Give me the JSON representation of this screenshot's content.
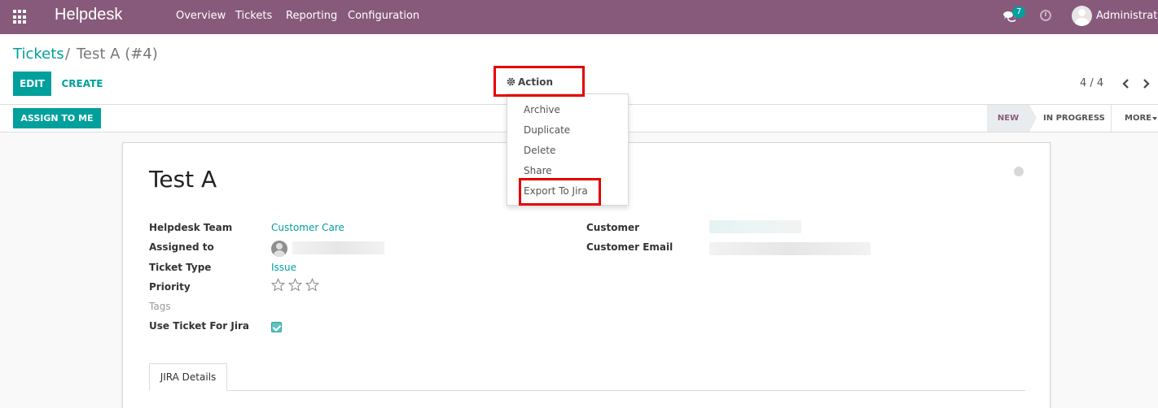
{
  "navbar": {
    "brand": "Helpdesk",
    "menu": [
      "Overview",
      "Tickets",
      "Reporting",
      "Configuration"
    ],
    "chat_count": "7",
    "user_name": "Administrator",
    "bg_color": "#875a7b"
  },
  "breadcrumb": {
    "parent": "Tickets",
    "separator": "/",
    "current": "Test A (#4)"
  },
  "toolbar": {
    "edit_label": "EDIT",
    "create_label": "CREATE",
    "action_label": "Action",
    "pager": "4 / 4"
  },
  "action_menu": {
    "items": [
      "Archive",
      "Duplicate",
      "Delete",
      "Share",
      "Export To Jira"
    ]
  },
  "statusbar": {
    "assign_label": "ASSIGN TO ME",
    "stages": [
      "NEW",
      "IN PROGRESS"
    ],
    "more_label": "MORE"
  },
  "form": {
    "title": "Test A",
    "fields": {
      "helpdesk_team_label": "Helpdesk Team",
      "helpdesk_team_value": "Customer Care",
      "assigned_to_label": "Assigned to",
      "ticket_type_label": "Ticket Type",
      "ticket_type_value": "Issue",
      "priority_label": "Priority",
      "tags_label": "Tags",
      "use_jira_label": "Use Ticket For Jira",
      "customer_label": "Customer",
      "customer_email_label": "Customer Email"
    },
    "priority_stars": 0,
    "use_jira_checked": true,
    "tabs": [
      "JIRA Details"
    ]
  },
  "colors": {
    "accent": "#00a09d",
    "highlight": "#e60000"
  }
}
